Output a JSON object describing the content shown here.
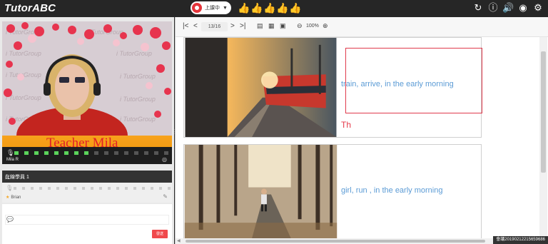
{
  "app": {
    "logo": "TutorABC"
  },
  "header": {
    "status_label": "上課中",
    "thumbs_count": 5
  },
  "video": {
    "banner_text": "Teacher Mila",
    "watermark_text": "i TutorGroup",
    "teacher_name": "Mila R",
    "level_on": 8,
    "level_total": 16
  },
  "online": {
    "title": "在線學員 1",
    "student_name": "Brian"
  },
  "chat": {
    "send_label": "發送"
  },
  "toolbar": {
    "page_indicator": "13/16",
    "zoom": "100%"
  },
  "slides": {
    "caption1": "train, arrive, in the early morning",
    "typed_text": "Th",
    "caption2": "girl, run , in the early morning"
  },
  "footer": {
    "watermark": "會議20190212215659686"
  },
  "icons": {
    "thumb": "thumbs-up-icon",
    "refresh": "refresh-icon",
    "info": "info-icon",
    "volume": "volume-icon",
    "camera": "webcam-icon",
    "settings": "gear-icon"
  },
  "colors": {
    "accent_red": "#e53a4a",
    "caption_blue": "#5b9bd5",
    "banner_orange": "#f39b11",
    "level_green": "#5bd45b"
  }
}
